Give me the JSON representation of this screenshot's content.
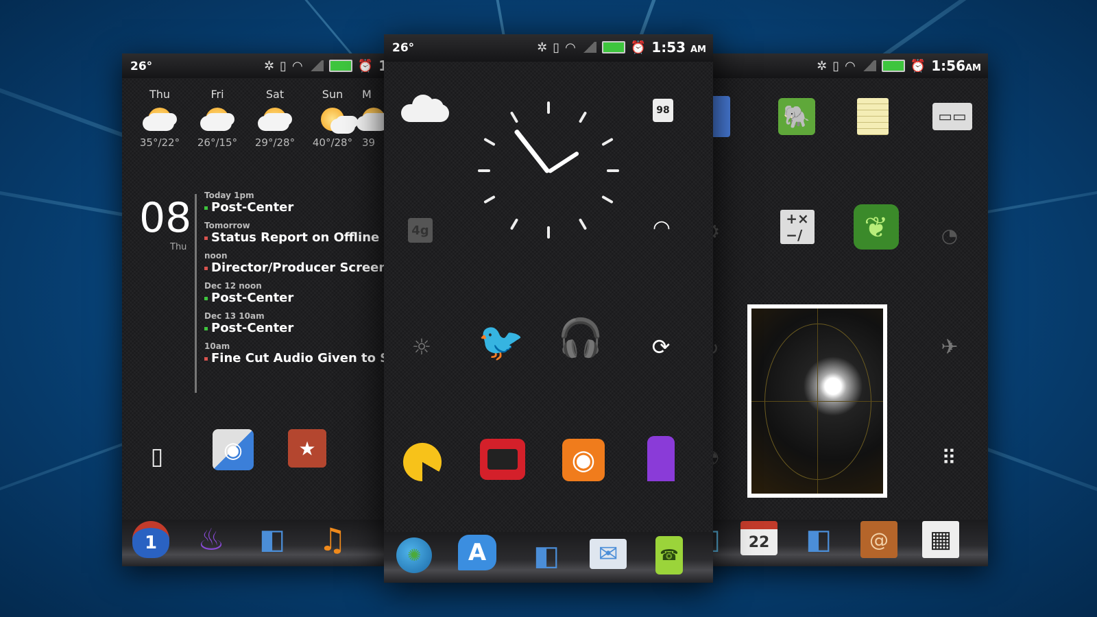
{
  "colors": {
    "accent": "#0d78c4",
    "battery": "#3ec53e",
    "agenda_dot_green": "#3ec53e",
    "agenda_dot_red": "#d9534f"
  },
  "left": {
    "status": {
      "temp": "26°",
      "time": "1"
    },
    "weather": [
      {
        "day": "Thu",
        "temp": "35°/22°"
      },
      {
        "day": "Fri",
        "temp": "26°/15°"
      },
      {
        "day": "Sat",
        "temp": "29°/28°"
      },
      {
        "day": "Sun",
        "temp": "40°/28°"
      },
      {
        "day": "M",
        "temp": "39"
      }
    ],
    "date": {
      "day_number": "08",
      "weekday": "Thu"
    },
    "agenda": [
      {
        "label": "Today   1pm",
        "title": "Post-Center",
        "dot": "green"
      },
      {
        "label": "Tomorrow",
        "title": "Status Report on Offline Fine",
        "dot": "red"
      },
      {
        "label": "noon",
        "title": "Director/Producer Screening",
        "dot": "red"
      },
      {
        "label": "Dec 12    noon",
        "title": "Post-Center",
        "dot": "green"
      },
      {
        "label": "Dec 13    10am",
        "title": "Post-Center",
        "dot": "green"
      },
      {
        "label": "10am",
        "title": "Fine Cut Audio Given to Sour",
        "dot": "red"
      }
    ],
    "shortcut_icons": [
      "vibrate-icon",
      "rss-reader-icon",
      "bookmark-star-icon"
    ],
    "dock": [
      "calendar-1-icon",
      "voice-mic-icon",
      "finder-icon",
      "music-note-icon"
    ],
    "calendar_badge": "1"
  },
  "center": {
    "status": {
      "temp": "26°",
      "time": "1:53",
      "ampm": "AM"
    },
    "battery_level": "98",
    "icons_row1": [
      "brightness-icon",
      "twitter-icon",
      "headphones-icon",
      "sync-icon"
    ],
    "icons_row2": [
      "pacman-icon",
      "tv-icon",
      "rss-icon",
      "purple-bookmark-icon"
    ],
    "dock": [
      "globe-icon",
      "app-store-icon",
      "finder-icon",
      "mail-icon",
      "phone-icon"
    ],
    "app_store_letter": "A",
    "fourg_label": "4g"
  },
  "right": {
    "status": {
      "time": "1:56",
      "ampm": "AM"
    },
    "calendar_badge": "22"
  }
}
